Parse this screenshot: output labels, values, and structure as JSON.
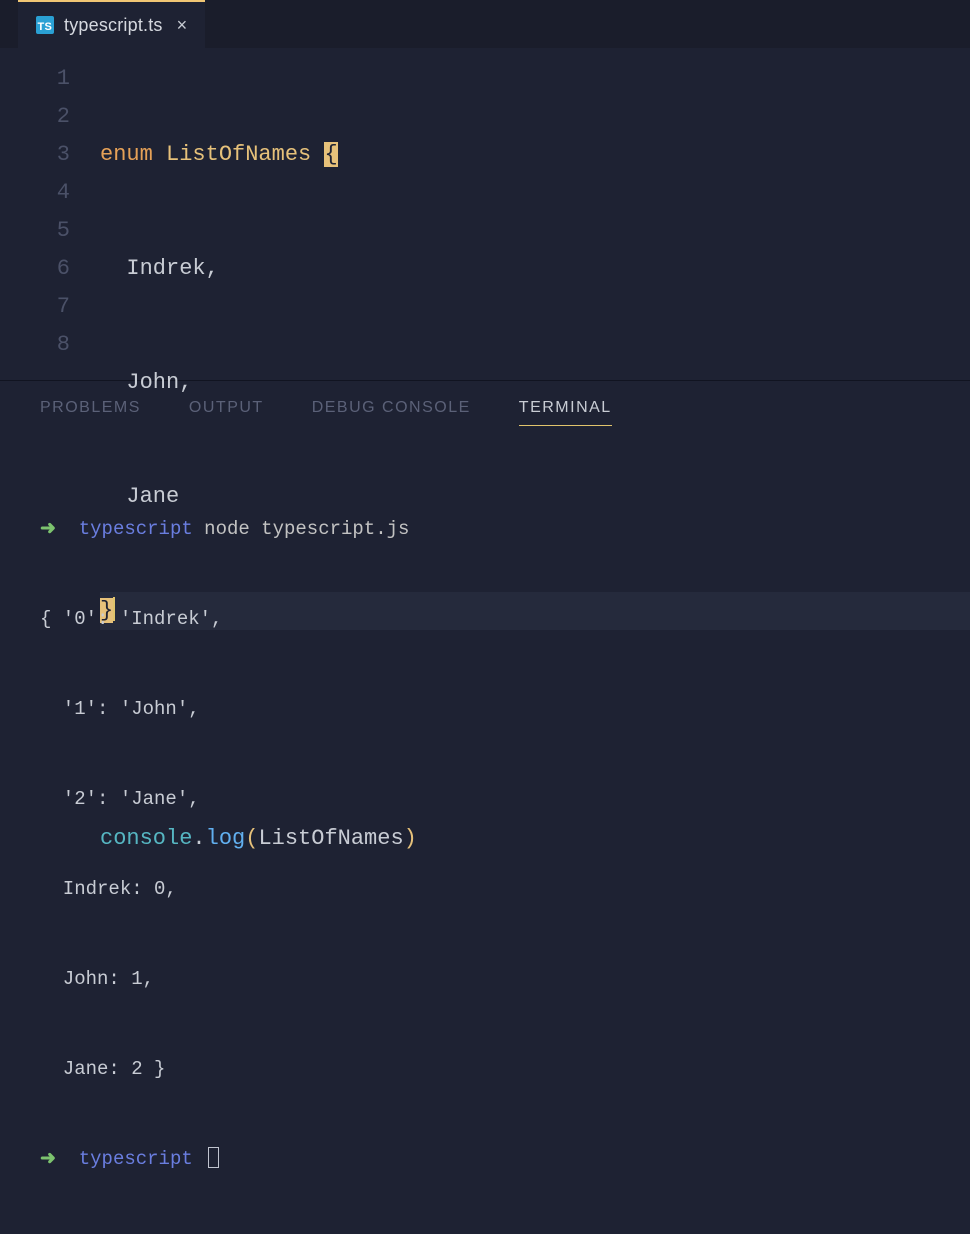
{
  "tab": {
    "icon_text": "TS",
    "filename": "typescript.ts"
  },
  "editor": {
    "line_numbers": [
      "1",
      "2",
      "3",
      "4",
      "5",
      "6",
      "7",
      "8"
    ],
    "code": {
      "enum_kw": "enum",
      "type_name": "ListOfNames",
      "brace_open": "{",
      "members": [
        "Indrek,",
        "John,",
        "Jane"
      ],
      "brace_close": "}",
      "console_obj": "console",
      "dot": ".",
      "log_fn": "log",
      "paren_open": "(",
      "arg": "ListOfNames",
      "paren_close": ")"
    }
  },
  "panel": {
    "tabs": {
      "problems": "PROBLEMS",
      "output": "OUTPUT",
      "debug": "DEBUG CONSOLE",
      "terminal": "TERMINAL"
    }
  },
  "terminal": {
    "arrow": "➜",
    "prompt": "typescript",
    "command": "node typescript.js",
    "output_lines": [
      "{ '0': 'Indrek',",
      "  '1': 'John',",
      "  '2': 'Jane',",
      "  Indrek: 0,",
      "  John: 1,",
      "  Jane: 2 }"
    ]
  }
}
